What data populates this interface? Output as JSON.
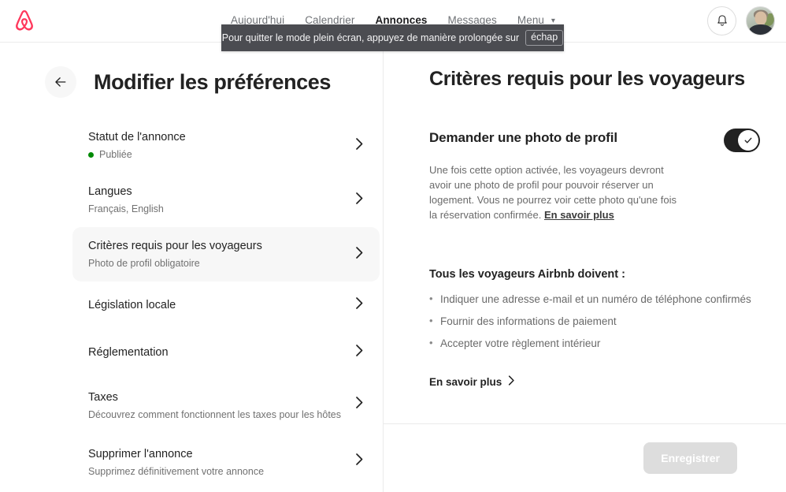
{
  "header": {
    "logo_icon": "airbnb-belo-logo",
    "logo_color": "#FF385C",
    "nav": [
      {
        "label": "Aujourd'hui",
        "active": false
      },
      {
        "label": "Calendrier",
        "active": false
      },
      {
        "label": "Annonces",
        "active": true
      },
      {
        "label": "Messages",
        "active": false
      },
      {
        "label": "Menu",
        "active": false,
        "chevron": "⌄"
      }
    ],
    "notifications_icon": "bell-icon",
    "profile_icon": "user-avatar"
  },
  "fullscreen_banner": {
    "text": "Pour quitter le mode plein écran, appuyez de manière prolongée sur",
    "key": "échap"
  },
  "left": {
    "back_icon": "back-arrow-icon",
    "title": "Modifier les préférences",
    "items": [
      {
        "label": "Statut de l'annonce",
        "sub": "Publiée",
        "has_status_dot": true,
        "status_color": "#008a05",
        "selected": false
      },
      {
        "label": "Langues",
        "sub": "Français, English",
        "has_status_dot": false,
        "selected": false
      },
      {
        "label": "Critères requis pour les voyageurs",
        "sub": "Photo de profil obligatoire",
        "has_status_dot": false,
        "selected": true
      },
      {
        "label": "Législation locale",
        "sub": "",
        "has_status_dot": false,
        "selected": false
      },
      {
        "label": "Réglementation",
        "sub": "",
        "has_status_dot": false,
        "selected": false
      },
      {
        "label": "Taxes",
        "sub": "Découvrez comment fonctionnent les taxes pour les hôtes",
        "has_status_dot": false,
        "selected": false
      },
      {
        "label": "Supprimer l'annonce",
        "sub": "Supprimez définitivement votre annonce",
        "has_status_dot": false,
        "selected": false
      }
    ]
  },
  "right": {
    "title": "Critères requis pour les voyageurs",
    "toggle": {
      "title": "Demander une photo de profil",
      "state": "on",
      "icon": "check-icon",
      "description": "Une fois cette option activée, les voyageurs devront avoir une photo de profil pour pouvoir réserver un logement. Vous ne pourrez voir cette photo qu'une fois la réservation confirmée.",
      "link_label": "En savoir plus"
    },
    "requirements": {
      "title": "Tous les voyageurs Airbnb doivent :",
      "items": [
        "Indiquer une adresse e-mail et un numéro de téléphone confirmés",
        "Fournir des informations de paiement",
        "Accepter votre règlement intérieur"
      ],
      "learn_more": "En savoir plus"
    }
  },
  "footer": {
    "save_label": "Enregistrer",
    "save_disabled": true
  }
}
